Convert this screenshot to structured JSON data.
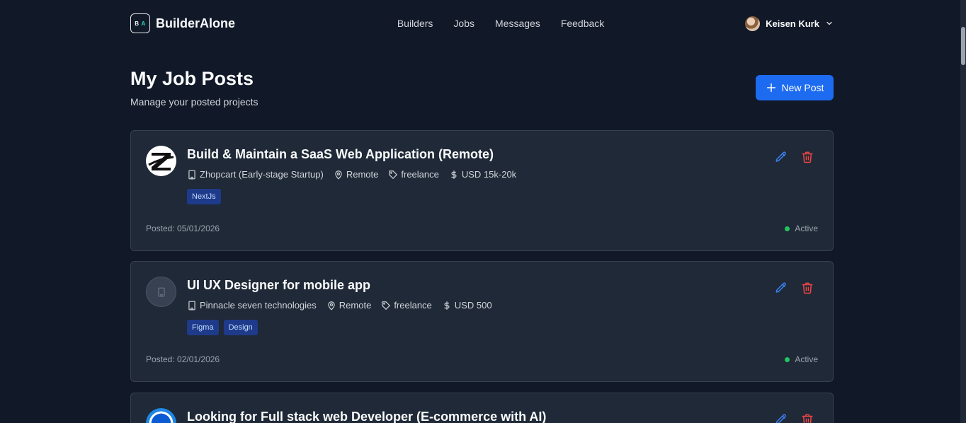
{
  "header": {
    "logo_left": "B",
    "logo_right": "A",
    "brand": "BuilderAlone",
    "nav": [
      "Builders",
      "Jobs",
      "Messages",
      "Feedback"
    ],
    "user_name": "Keisen Kurk"
  },
  "page": {
    "title": "My Job Posts",
    "subtitle": "Manage your posted projects",
    "new_post_label": "New Post"
  },
  "jobs": [
    {
      "title": "Build & Maintain a SaaS Web Application (Remote)",
      "company": "Zhopcart (Early-stage Startup)",
      "location": "Remote",
      "type": "freelance",
      "budget": "USD 15k-20k",
      "tags": [
        "NextJs"
      ],
      "posted": "Posted: 05/01/2026",
      "status": "Active",
      "logo_letter": "Z"
    },
    {
      "title": "UI UX Designer for mobile app",
      "company": "Pinnacle seven technologies",
      "location": "Remote",
      "type": "freelance",
      "budget": "USD 500",
      "tags": [
        "Figma",
        "Design"
      ],
      "posted": "Posted: 02/01/2026",
      "status": "Active"
    },
    {
      "title": "Looking for Full stack web Developer (E-commerce with AI)"
    }
  ],
  "colors": {
    "background": "#111827",
    "card": "#1f2937",
    "accent": "#1d6bf0",
    "edit": "#3b82f6",
    "delete": "#ef4444",
    "active": "#22c55e"
  },
  "icons": [
    "chevron-down-icon",
    "plus-icon",
    "building-icon",
    "map-pin-icon",
    "tag-icon",
    "dollar-icon",
    "pencil-icon",
    "trash-icon"
  ]
}
